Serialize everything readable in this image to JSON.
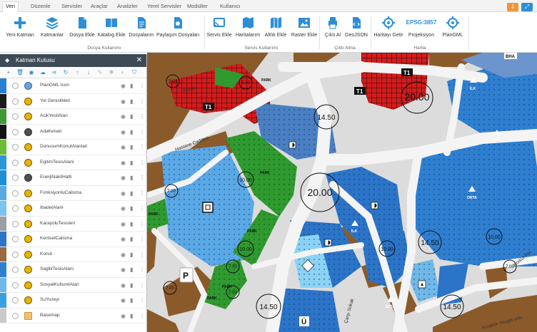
{
  "tabs": [
    "Veri",
    "Düzenle",
    "Servisler",
    "Araçlar",
    "Analizler",
    "Yerel Servisler",
    "Modüller",
    "Kullanıcı"
  ],
  "active_tab": "Veri",
  "ribbon": {
    "buttons": {
      "yeni_katman": "Yeni Katman",
      "katmanlar": "Katmanlar",
      "dosya_ekle": "Dosya Ekle",
      "katalog_ekle": "Katalog Ekle",
      "dosyalarim": "Dosyalarım",
      "paylasim_dosyalari": "Paylaşım Dosyaları",
      "servis_ekle": "Servis Ekle",
      "haritalarim": "Haritalarım",
      "altlik_ekle": "Altlık Ekle",
      "raster_ekle": "Raster Ekle",
      "cikti_al": "Çıktı Al",
      "geojson": "GeoJSON",
      "haritayi_getir": "Haritayı Getir",
      "projeksiyon": "Projeksiyon",
      "plangml": "PlanGML"
    },
    "epsg": "EPSG:3857",
    "groups": {
      "dosya": "Dosya Kullanımı",
      "servis": "Servis Kullanımı",
      "cikti": "Çıktı Alma",
      "harita": "Harita"
    }
  },
  "panel": {
    "title": "Katman Kutusu",
    "layers": [
      {
        "name": "PlanGML Icon",
        "color": "#2a7fd4",
        "sym": "globe"
      },
      {
        "name": "Yol Genislikleri",
        "color": "#1a1a1a",
        "sym": "yellow"
      },
      {
        "name": "AcikYesilAlan",
        "color": "#3e9a35",
        "sym": "yellow"
      },
      {
        "name": "AdaKenari",
        "color": "#111111",
        "sym": "grey"
      },
      {
        "name": "DonusumKonutAlanlari",
        "color": "#6dbb3a",
        "sym": "yellow"
      },
      {
        "name": "EgitimTesisAlani",
        "color": "#2d95d8",
        "sym": "yellow"
      },
      {
        "name": "EnerjiNakilHatti",
        "color": "#1f8fd6",
        "sym": "grey"
      },
      {
        "name": "FonksiyonluCalisma",
        "color": "#5aa9e6",
        "sym": "yellow"
      },
      {
        "name": "IbadetAlani",
        "color": "#7ac4ee",
        "sym": "yellow"
      },
      {
        "name": "KarayoluTesisleri",
        "color": "#9aa1a6",
        "sym": "yellow"
      },
      {
        "name": "KentselCalisma",
        "color": "#2b74c7",
        "sym": "yellow"
      },
      {
        "name": "Konut",
        "color": "#9a6b3f",
        "sym": "yellow"
      },
      {
        "name": "SaglikTesisAlani",
        "color": "#2f7fd1",
        "sym": "yellow"
      },
      {
        "name": "SosyalKulturelAlan",
        "color": "#6fb8e8",
        "sym": "yellow"
      },
      {
        "name": "SuYuzeyi",
        "color": "#39a0e0",
        "sym": "yellow"
      },
      {
        "name": "Basemap",
        "color": "#c9c9c9",
        "sym": "folder"
      }
    ]
  },
  "map": {
    "labels": {
      "park": "PARK",
      "t1": "T1",
      "bha": "BHA",
      "ilk": "İLK",
      "orta": "ORTA",
      "hastane_caddesi": "Hastane Caddesi",
      "sokak": "Sokak",
      "korkut_ata": "Korkut Ata",
      "carsi_sokak": "Çarşı Sokak",
      "kirsehir_yozgat": "Kırşehir-Yozgat yolu",
      "parking": "P",
      "u": "Ü"
    },
    "widths": [
      "20.00",
      "14.50",
      "10.00",
      "7.00"
    ],
    "colors": {
      "konut": "#8a5a2b",
      "egitim": "#3a8fe0",
      "egitim_light": "#8bd3f5",
      "park": "#2f9a2f",
      "commercial": "#d71a1a",
      "road": "#f4f4f4",
      "block": "#dcdcdc"
    }
  }
}
